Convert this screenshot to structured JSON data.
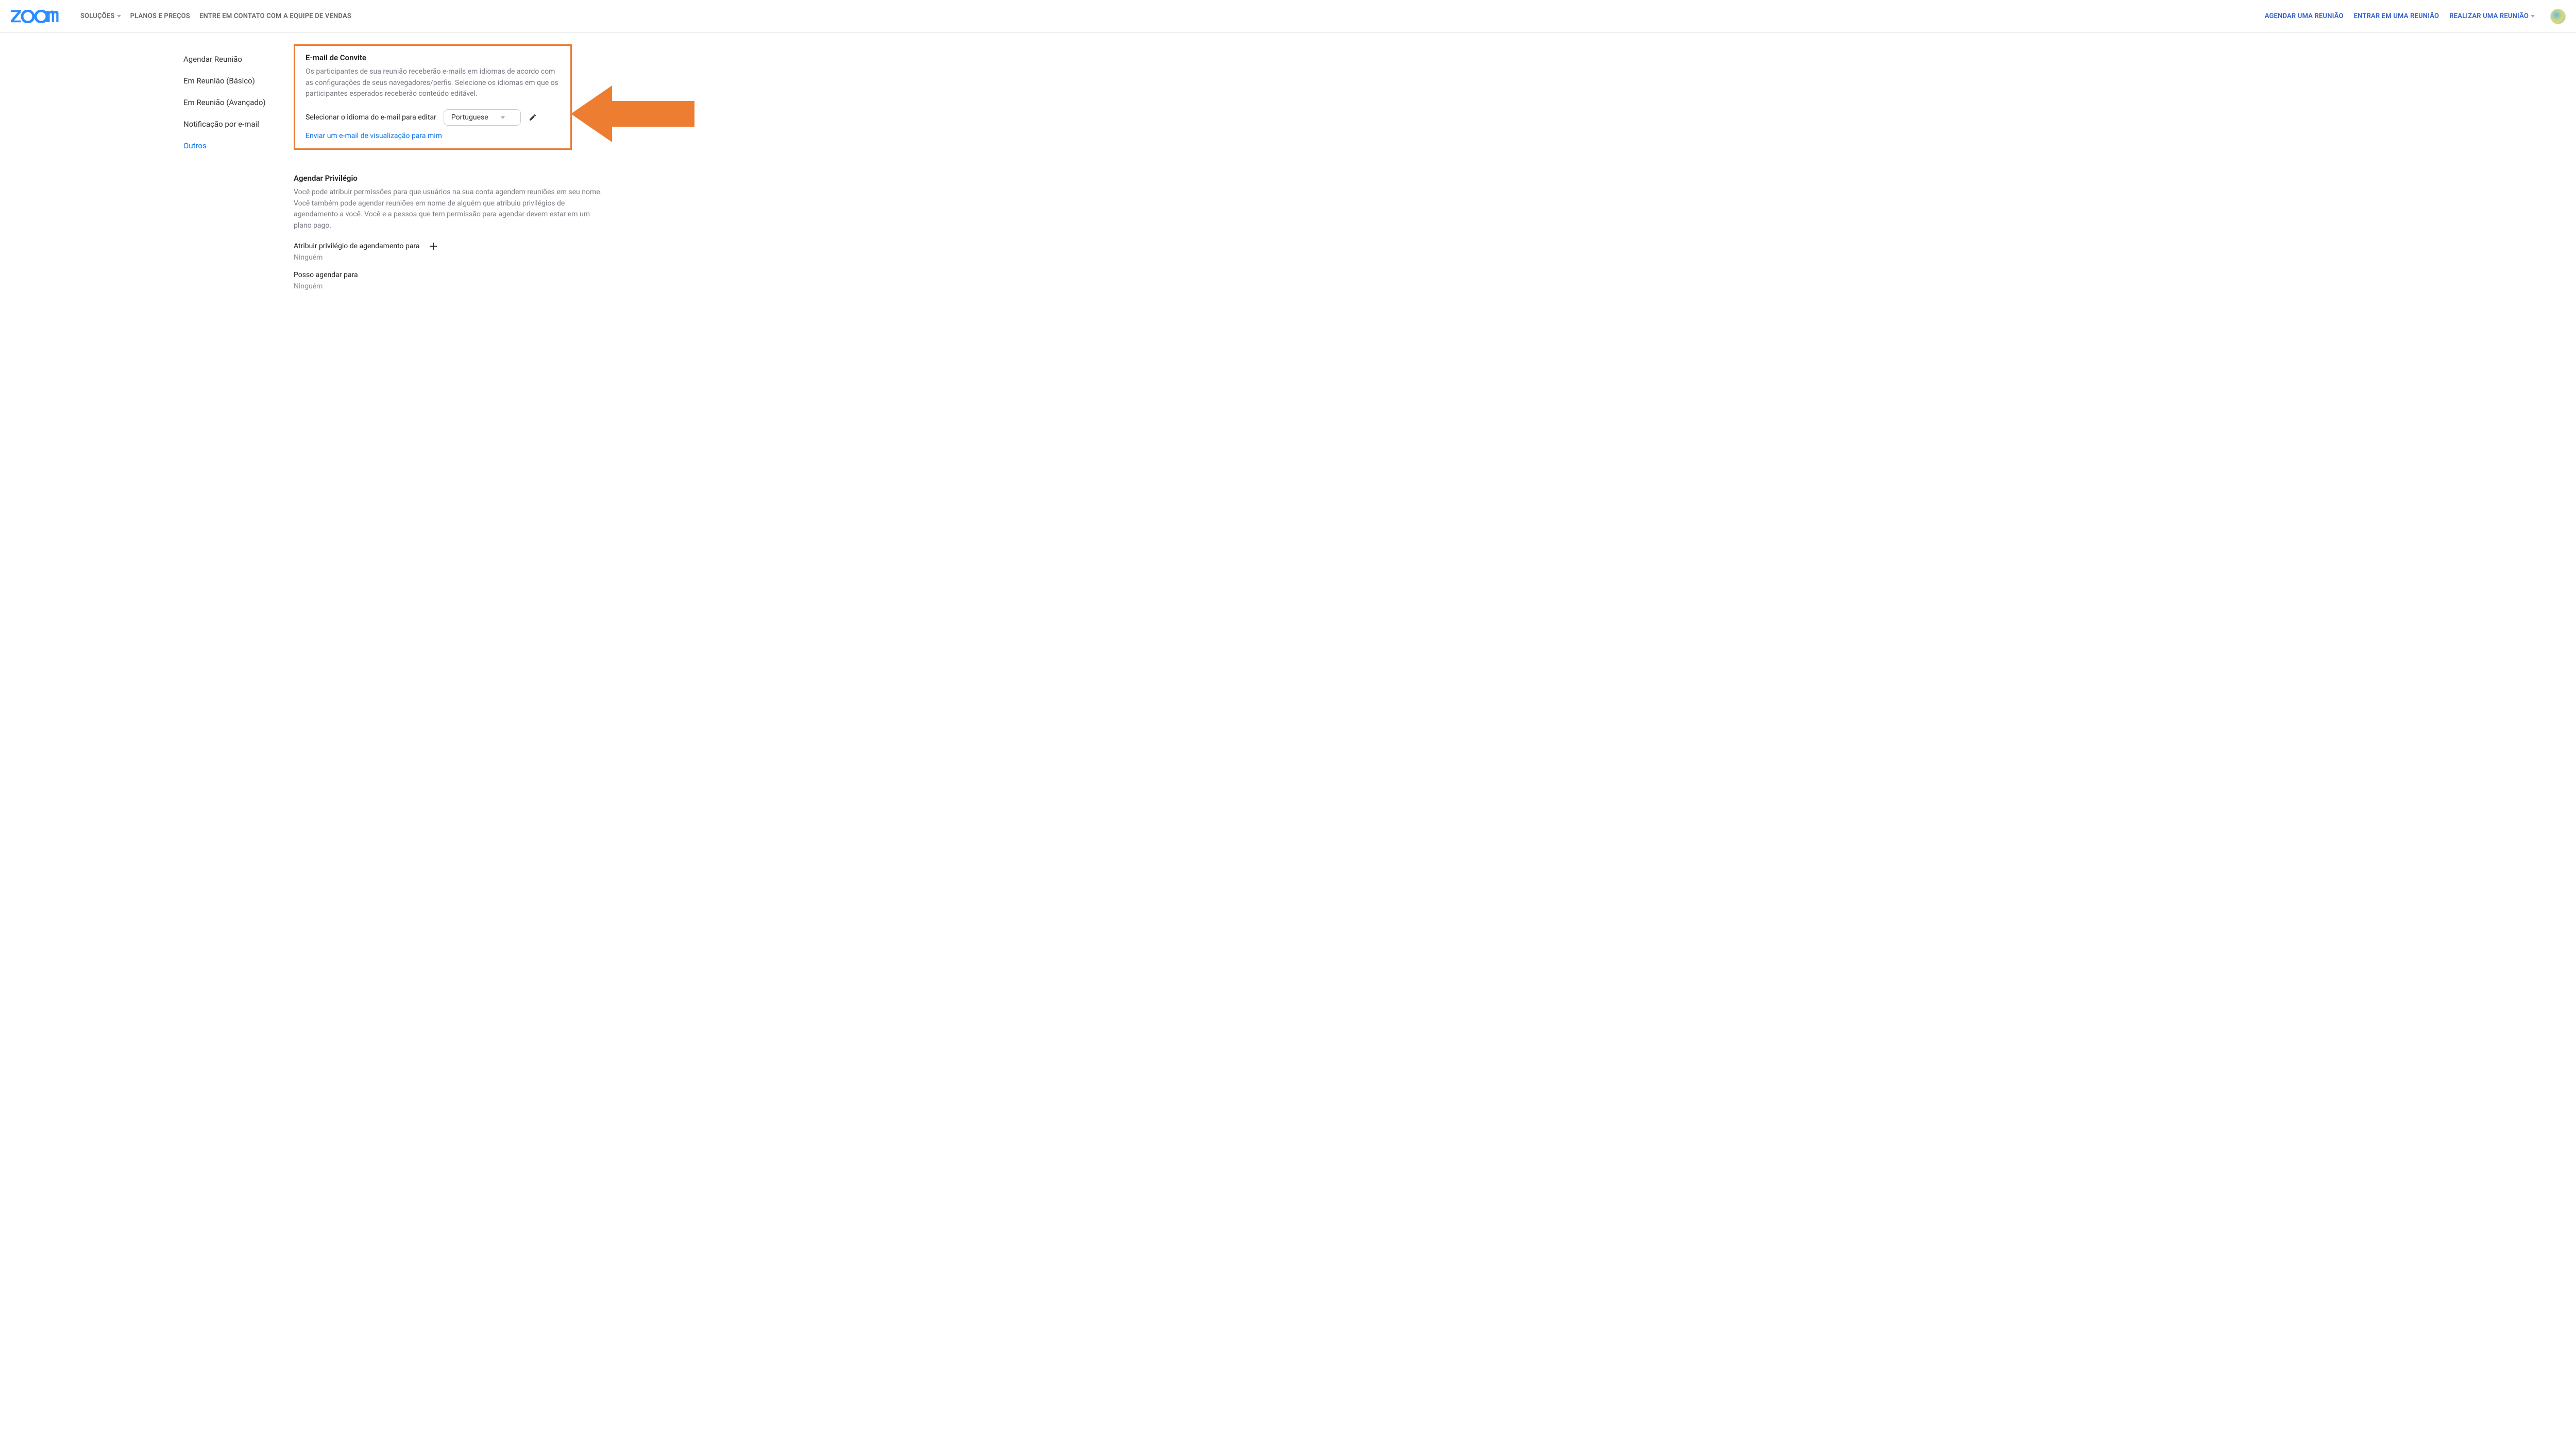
{
  "header": {
    "brand": "zoom",
    "nav_left": {
      "solucoes": "SOLUÇÕES",
      "planos": "PLANOS E PREÇOS",
      "contato": "ENTRE EM CONTATO COM A EQUIPE DE VENDAS"
    },
    "nav_right": {
      "agendar": "AGENDAR UMA REUNIÃO",
      "entrar": "ENTRAR EM UMA REUNIÃO",
      "realizar": "REALIZAR UMA REUNIÃO"
    }
  },
  "tabs": {
    "agendar": "Agendar Reunião",
    "basico": "Em Reunião (Básico)",
    "avancado": "Em Reunião (Avançado)",
    "notif": "Notificação por e-mail",
    "outros": "Outros"
  },
  "invite": {
    "title": "E-mail de Convite",
    "desc": "Os participantes de sua reunião receberão e-mails em idiomas de acordo com as configurações de seus navegadores/perfis. Selecione os idiomas em que os participantes esperados receberão conteúdo editável.",
    "select_label": "Selecionar o idioma do e-mail para editar",
    "select_value": "Portuguese",
    "preview_link": "Enviar um e-mail de visualização para mim"
  },
  "priv": {
    "title": "Agendar Privilégio",
    "desc": "Você pode atribuir permissões para que usuários na sua conta agendem reuniões em seu nome. Você também pode agendar reuniões em nome de alguém que atribuiu privilégios de agendamento a você. Você e a pessoa que tem permissão para agendar devem estar em um plano pago.",
    "assign_label": "Atribuir privilégio de agendamento para",
    "assign_value": "Ninguém",
    "can_label": "Posso agendar para",
    "can_value": "Ninguém"
  }
}
